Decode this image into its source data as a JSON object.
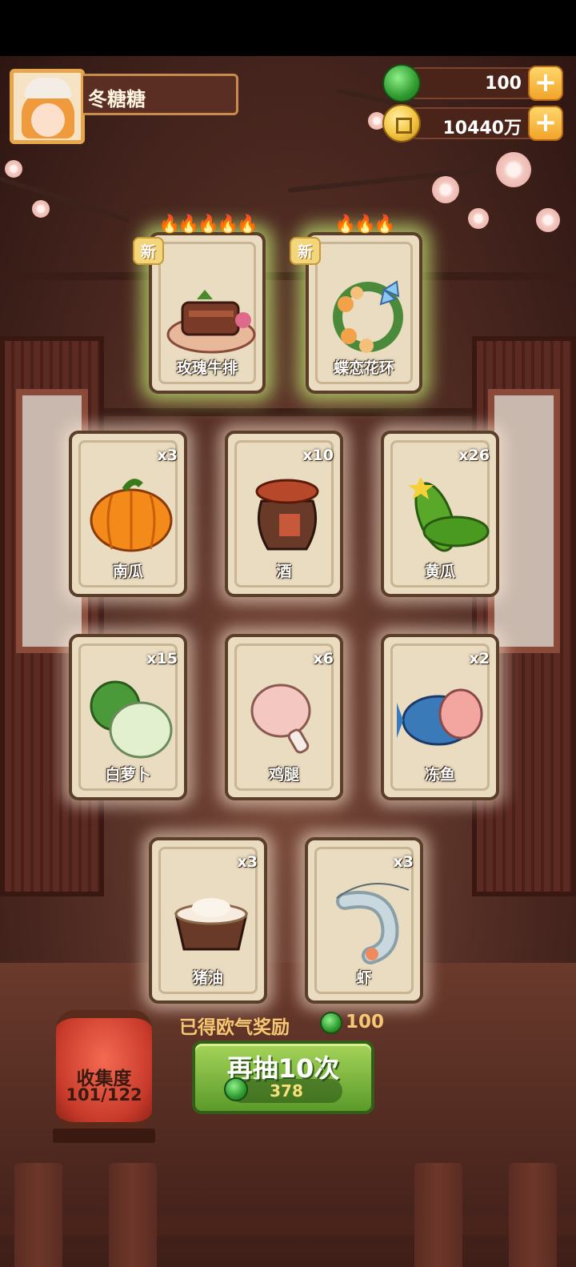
{
  "player": {
    "name": "冬糖糖"
  },
  "currency": {
    "jade": {
      "value": "100",
      "icon": "jade-coin-icon"
    },
    "gold": {
      "value": "10440万",
      "icon": "gold-coin-icon"
    },
    "plus": "+"
  },
  "featured_cards": [
    {
      "name": "玫瑰牛排",
      "badge": "新",
      "flames": "🔥🔥🔥🔥🔥"
    },
    {
      "name": "蝶恋花环",
      "badge": "新",
      "flames": "🔥🔥🔥"
    }
  ],
  "cards": [
    {
      "name": "南瓜",
      "count": "x3"
    },
    {
      "name": "酒",
      "count": "x10"
    },
    {
      "name": "黄瓜",
      "count": "x26"
    },
    {
      "name": "白萝卜",
      "count": "x15"
    },
    {
      "name": "鸡腿",
      "count": "x6"
    },
    {
      "name": "冻鱼",
      "count": "x2"
    },
    {
      "name": "猪油",
      "count": "x3"
    },
    {
      "name": "虾",
      "count": "x3"
    }
  ],
  "reward": {
    "label": "已得欧气奖励",
    "value": "100"
  },
  "draw_button": {
    "label": "再抽10次",
    "cost": "378"
  },
  "collection": {
    "label": "收集度",
    "value": "101/122"
  },
  "colors": {
    "jade": "#2f9a2e",
    "gold": "#f3c440",
    "button_green": "#7fb640",
    "lantern_red": "#c83a2a"
  }
}
